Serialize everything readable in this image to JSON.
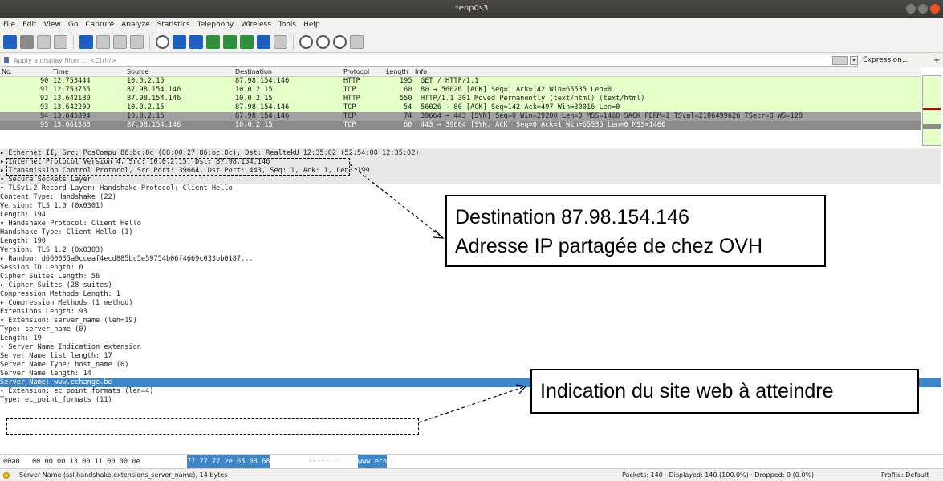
{
  "window": {
    "title": "*enp0s3"
  },
  "menu": [
    "File",
    "Edit",
    "View",
    "Go",
    "Capture",
    "Analyze",
    "Statistics",
    "Telephony",
    "Wireless",
    "Tools",
    "Help"
  ],
  "filter": {
    "placeholder": "Apply a display filter ... <Ctrl-/>",
    "expression_label": "Expression...",
    "plus_label": "+"
  },
  "packet_list": {
    "headers": {
      "no": "No.",
      "time": "Time",
      "source": "Source",
      "destination": "Destination",
      "protocol": "Protocol",
      "length": "Length",
      "info": "Info"
    },
    "rows": [
      {
        "no": "90",
        "time": "12.753444",
        "source": "10.0.2.15",
        "destination": "87.98.154.146",
        "protocol": "HTTP",
        "length": "195",
        "info": "GET / HTTP/1.1"
      },
      {
        "no": "91",
        "time": "12.753755",
        "source": "87.98.154.146",
        "destination": "10.0.2.15",
        "protocol": "TCP",
        "length": "60",
        "info": "80 → 56026 [ACK] Seq=1 Ack=142 Win=65535 Len=0"
      },
      {
        "no": "92",
        "time": "13.642180",
        "source": "87.98.154.146",
        "destination": "10.0.2.15",
        "protocol": "HTTP",
        "length": "550",
        "info": "HTTP/1.1 301 Moved Permanently  (text/html) (text/html)"
      },
      {
        "no": "93",
        "time": "13.642209",
        "source": "10.0.2.15",
        "destination": "87.98.154.146",
        "protocol": "TCP",
        "length": "54",
        "info": "56026 → 80 [ACK] Seq=142 Ack=497 Win=30016 Len=0"
      },
      {
        "no": "94",
        "time": "13.645094",
        "source": "10.0.2.15",
        "destination": "87.98.154.146",
        "protocol": "TCP",
        "length": "74",
        "info": "39664 → 443 [SYN] Seq=0 Win=29200 Len=0 MSS=1460 SACK_PERM=1 TSval=2106499626 TSecr=0 WS=128"
      },
      {
        "no": "95",
        "time": "13.661383",
        "source": "87.98.154.146",
        "destination": "10.0.2.15",
        "protocol": "TCP",
        "length": "60",
        "info": "443 → 39664 [SYN, ACK] Seq=0 Ack=1 Win=65535 Len=0 MSS=1460"
      }
    ]
  },
  "details": [
    "▸ Ethernet II, Src: PcsCompu_86:bc:8c (08:00:27:86:bc:8c), Dst: RealtekU_12:35:02 (52:54:00:12:35:02)",
    "▸ Internet Protocol Version 4, Src: 10.0.2.15, Dst: 87.98.154.146",
    "▸ Transmission Control Protocol, Src Port: 39664, Dst Port: 443, Seq: 1, Ack: 1, Len: 199",
    "▾ Secure Sockets Layer",
    "   ▾ TLSv1.2 Record Layer: Handshake Protocol: Client Hello",
    "       Content Type: Handshake (22)",
    "       Version: TLS 1.0 (0x0301)",
    "       Length: 194",
    "     ▾ Handshake Protocol: Client Hello",
    "         Handshake Type: Client Hello (1)",
    "         Length: 190",
    "         Version: TLS 1.2 (0x0303)",
    "       ▸ Random: d660035a9cceaf4ecd885bc5e59754b06f4669c033bb0187...",
    "         Session ID Length: 0",
    "         Cipher Suites Length: 56",
    "       ▸ Cipher Suites (28 suites)",
    "         Compression Methods Length: 1",
    "       ▸ Compression Methods (1 method)",
    "         Extensions Length: 93",
    "       ▾ Extension: server_name (len=19)",
    "           Type: server_name (0)",
    "           Length: 19",
    "         ▾ Server Name Indication extension",
    "             Server Name list length: 17",
    "             Server Name Type: host_name (0)",
    "             Server Name length: 14",
    "             Server Name: www.echange.be",
    "       ▾ Extension: ec_point_formats (len=4)",
    "           Type: ec_point_formats (11)"
  ],
  "bytes_pane": {
    "offset": "00a0",
    "hex_plain": "00 00 00 13 00 11 00 00  0e",
    "hex_selected": "77 77 77 2e 65 63 68",
    "ascii_plain": "········",
    "ascii_selected": "www.ech"
  },
  "status": {
    "field": "Server Name (ssl.handshake.extensions_server_name), 14 bytes",
    "packets": "Packets: 140 · Displayed: 140 (100.0%) · Dropped: 0 (0.0%)",
    "profile": "Profile: Default"
  },
  "annotations": {
    "destination_line1": "Destination 87.98.154.146",
    "destination_line2": "Adresse IP partagée de chez OVH",
    "sni": "Indication du site web à atteindre"
  },
  "colors": {
    "http_tcp_row": "#e4ffc7",
    "selected": "#3d87c9",
    "gray_row": "#a0a0a0"
  }
}
